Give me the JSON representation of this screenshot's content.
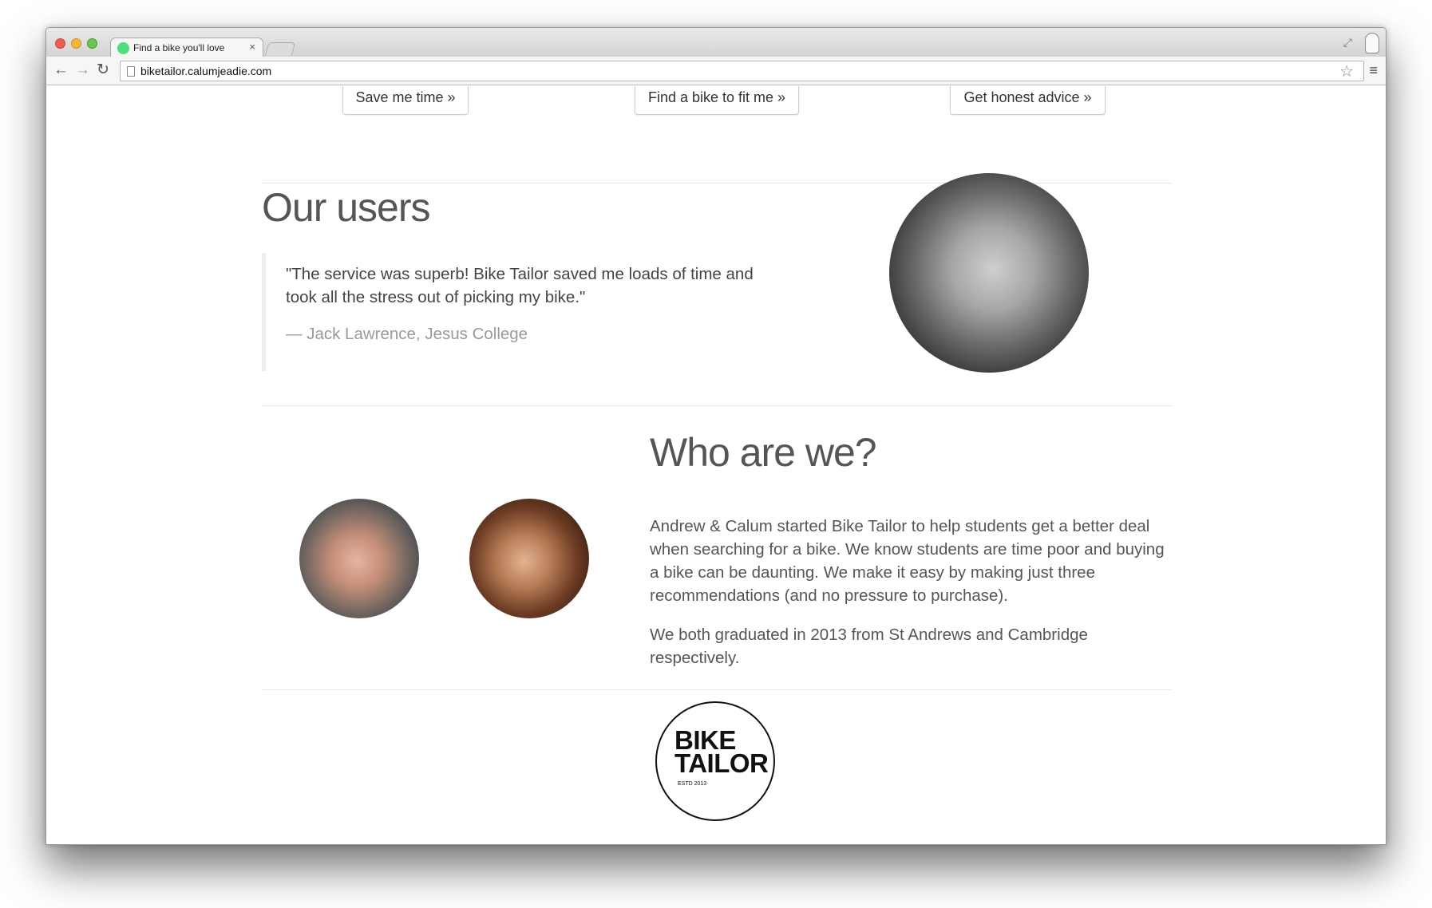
{
  "browser": {
    "tab_title": "Find a bike you'll love",
    "tab_close": "×",
    "url": "biketailor.calumjeadie.com",
    "nav": {
      "back": "←",
      "forward": "→",
      "reload": "↻"
    },
    "icons": {
      "star": "☆",
      "menu": "≡",
      "expand": "⤢"
    }
  },
  "cta_buttons": [
    {
      "label": "Save me time »"
    },
    {
      "label": "Find a bike to fit me »"
    },
    {
      "label": "Get honest advice »"
    }
  ],
  "users_section": {
    "heading": "Our users",
    "quote": "\"The service was superb! Bike Tailor saved me loads of time and took all the stress out of picking my bike.\"",
    "author": "— Jack Lawrence, Jesus College"
  },
  "about_section": {
    "heading": "Who are we?",
    "paragraph1": "Andrew & Calum started Bike Tailor to help students get a better deal when searching for a bike. We know students are time poor and buying a bike can be daunting. We make it easy by making just three recommendations (and no pressure to purchase).",
    "paragraph2": "We both graduated in 2013 from St Andrews and Cambridge respectively."
  },
  "logo": {
    "line1": "BIKE",
    "line2": "TAILOR",
    "estd": "ESTD 2013"
  }
}
